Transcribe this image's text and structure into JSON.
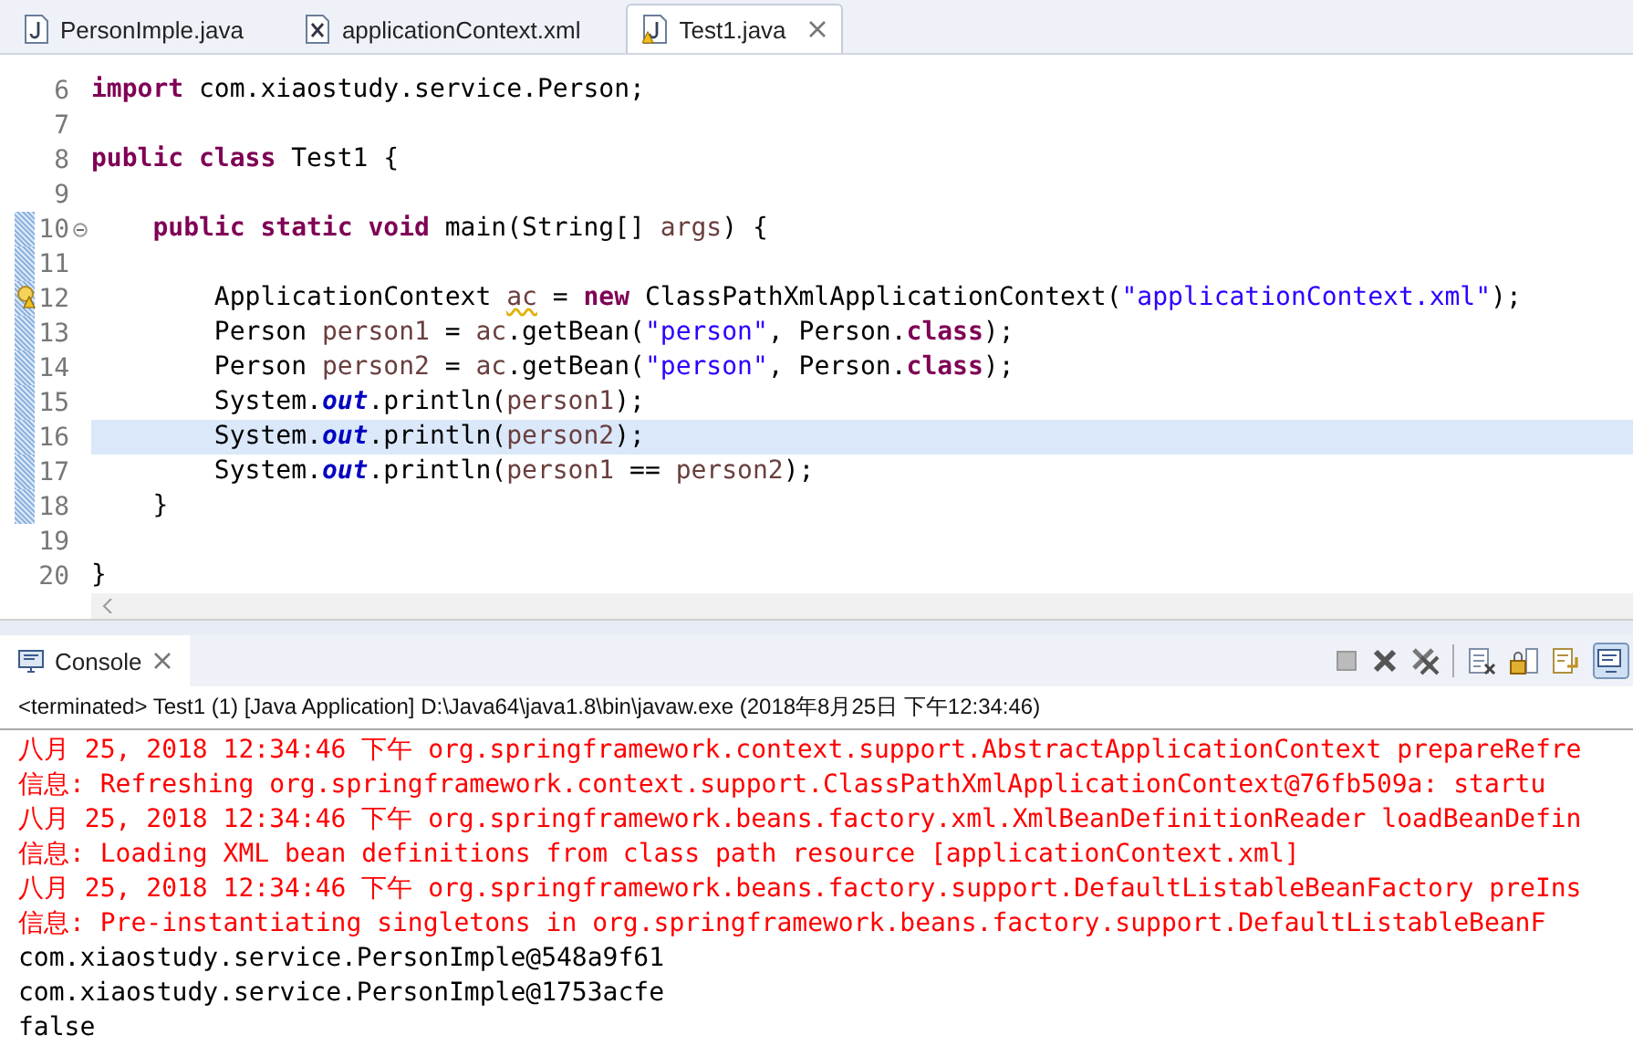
{
  "editor_tabs": [
    {
      "label": "PersonImple.java",
      "kind": "java",
      "selected": false,
      "warning": false
    },
    {
      "label": "applicationContext.xml",
      "kind": "xml",
      "selected": false,
      "warning": false
    },
    {
      "label": "Test1.java",
      "kind": "java",
      "selected": true,
      "warning": true
    }
  ],
  "code_lines": [
    {
      "number": "6",
      "current": false,
      "range": false,
      "folding": false,
      "warning": false,
      "tokens": [
        {
          "kind": "kw",
          "text": "import"
        },
        {
          "kind": "plain",
          "text": " com.xiaostudy.service.Person;"
        }
      ]
    },
    {
      "number": "7",
      "current": false,
      "range": false,
      "folding": false,
      "warning": false
    },
    {
      "number": "8",
      "current": false,
      "range": false,
      "folding": false,
      "warning": false,
      "tokens": [
        {
          "kind": "kw",
          "text": "public class"
        },
        {
          "kind": "plain",
          "text": " Test1 {"
        }
      ]
    },
    {
      "number": "9",
      "current": false,
      "range": false,
      "folding": false,
      "warning": false
    },
    {
      "number": "10",
      "current": false,
      "range": true,
      "folding": true,
      "warning": false,
      "tokens": [
        {
          "kind": "kw",
          "text": "    public static void"
        },
        {
          "kind": "plain",
          "text": " main(String[] "
        },
        {
          "kind": "var",
          "text": "args"
        },
        {
          "kind": "plain",
          "text": ") {"
        }
      ]
    },
    {
      "number": "11",
      "current": false,
      "range": true,
      "folding": false,
      "warning": false
    },
    {
      "number": "12",
      "current": false,
      "range": true,
      "folding": false,
      "warning": true,
      "tokens": [
        {
          "kind": "plain",
          "text": "        ApplicationContext "
        },
        {
          "kind": "warnvar",
          "text": "ac"
        },
        {
          "kind": "plain",
          "text": " = "
        },
        {
          "kind": "kw",
          "text": "new"
        },
        {
          "kind": "plain",
          "text": " ClassPathXmlApplicationContext("
        },
        {
          "kind": "str",
          "text": "\"applicationContext.xml\""
        },
        {
          "kind": "plain",
          "text": ");"
        }
      ]
    },
    {
      "number": "13",
      "current": false,
      "range": true,
      "folding": false,
      "warning": false,
      "tokens": [
        {
          "kind": "plain",
          "text": "        Person "
        },
        {
          "kind": "var",
          "text": "person1"
        },
        {
          "kind": "plain",
          "text": " = "
        },
        {
          "kind": "var",
          "text": "ac"
        },
        {
          "kind": "plain",
          "text": ".getBean("
        },
        {
          "kind": "str",
          "text": "\"person\""
        },
        {
          "kind": "plain",
          "text": ", Person."
        },
        {
          "kind": "kw",
          "text": "class"
        },
        {
          "kind": "plain",
          "text": ");"
        }
      ]
    },
    {
      "number": "14",
      "current": false,
      "range": true,
      "folding": false,
      "warning": false,
      "tokens": [
        {
          "kind": "plain",
          "text": "        Person "
        },
        {
          "kind": "var",
          "text": "person2"
        },
        {
          "kind": "plain",
          "text": " = "
        },
        {
          "kind": "var",
          "text": "ac"
        },
        {
          "kind": "plain",
          "text": ".getBean("
        },
        {
          "kind": "str",
          "text": "\"person\""
        },
        {
          "kind": "plain",
          "text": ", Person."
        },
        {
          "kind": "kw",
          "text": "class"
        },
        {
          "kind": "plain",
          "text": ");"
        }
      ]
    },
    {
      "number": "15",
      "current": false,
      "range": true,
      "folding": false,
      "warning": false,
      "tokens": [
        {
          "kind": "plain",
          "text": "        System."
        },
        {
          "kind": "field",
          "text": "out"
        },
        {
          "kind": "plain",
          "text": ".println("
        },
        {
          "kind": "var",
          "text": "person1"
        },
        {
          "kind": "plain",
          "text": ");"
        }
      ]
    },
    {
      "number": "16",
      "current": true,
      "range": true,
      "folding": false,
      "warning": false,
      "tokens": [
        {
          "kind": "plain",
          "text": "        System."
        },
        {
          "kind": "field",
          "text": "out"
        },
        {
          "kind": "plain",
          "text": ".println("
        },
        {
          "kind": "var",
          "text": "person2"
        },
        {
          "kind": "plain",
          "text": ");"
        }
      ]
    },
    {
      "number": "17",
      "current": false,
      "range": true,
      "folding": false,
      "warning": false,
      "tokens": [
        {
          "kind": "plain",
          "text": "        System."
        },
        {
          "kind": "field",
          "text": "out"
        },
        {
          "kind": "plain",
          "text": ".println("
        },
        {
          "kind": "var",
          "text": "person1"
        },
        {
          "kind": "plain",
          "text": " == "
        },
        {
          "kind": "var",
          "text": "person2"
        },
        {
          "kind": "plain",
          "text": ");"
        }
      ]
    },
    {
      "number": "18",
      "current": false,
      "range": true,
      "folding": false,
      "warning": false,
      "tokens": [
        {
          "kind": "plain",
          "text": "    }"
        }
      ]
    },
    {
      "number": "19",
      "current": false,
      "range": false,
      "folding": false,
      "warning": false
    },
    {
      "number": "20",
      "current": false,
      "range": false,
      "folding": false,
      "warning": false,
      "tokens": [
        {
          "kind": "plain",
          "text": "}"
        }
      ]
    }
  ],
  "console": {
    "title": "Console",
    "status": "<terminated> Test1 (1) [Java Application] D:\\Java64\\java1.8\\bin\\javaw.exe (2018年8月25日 下午12:34:46)",
    "lines": [
      {
        "color": "#ff0000",
        "text": "八月 25, 2018 12:34:46 下午 org.springframework.context.support.AbstractApplicationContext prepareRefre"
      },
      {
        "color": "#ff0000",
        "text": "信息: Refreshing org.springframework.context.support.ClassPathXmlApplicationContext@76fb509a: startu"
      },
      {
        "color": "#ff0000",
        "text": "八月 25, 2018 12:34:46 下午 org.springframework.beans.factory.xml.XmlBeanDefinitionReader loadBeanDefin"
      },
      {
        "color": "#ff0000",
        "text": "信息: Loading XML bean definitions from class path resource [applicationContext.xml]"
      },
      {
        "color": "#ff0000",
        "text": "八月 25, 2018 12:34:46 下午 org.springframework.beans.factory.support.DefaultListableBeanFactory preIns"
      },
      {
        "color": "#ff0000",
        "text": "信息: Pre-instantiating singletons in org.springframework.beans.factory.support.DefaultListableBeanF"
      },
      {
        "color": "#000000",
        "text": "com.xiaostudy.service.PersonImple@548a9f61"
      },
      {
        "color": "#000000",
        "text": "com.xiaostudy.service.PersonImple@1753acfe"
      },
      {
        "color": "#000000",
        "text": "false"
      }
    ]
  }
}
